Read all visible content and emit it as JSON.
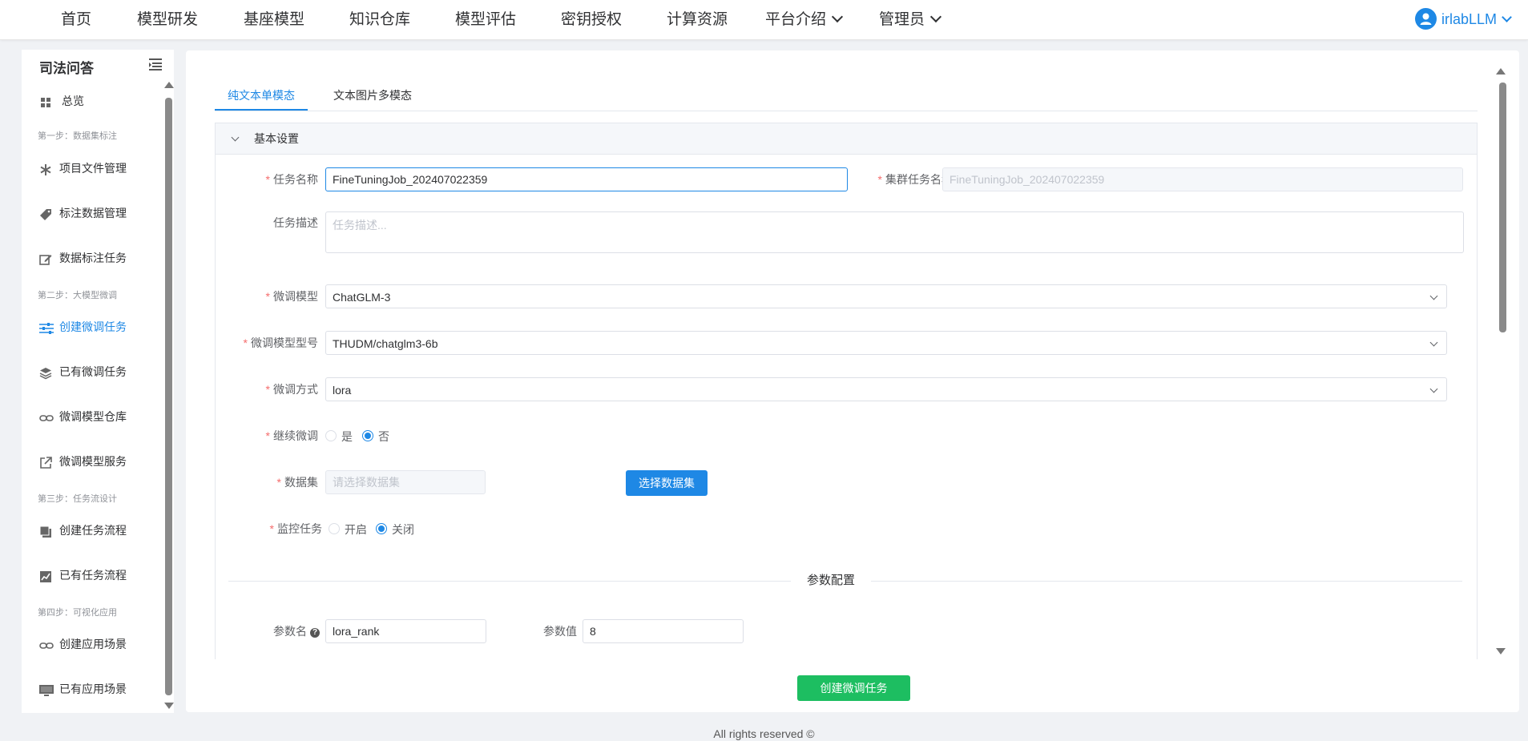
{
  "nav": {
    "items": [
      "首页",
      "模型研发",
      "基座模型",
      "知识仓库",
      "模型评估",
      "密钥授权",
      "计算资源",
      "平台介绍",
      "管理员"
    ],
    "user": "irlabLLM"
  },
  "sidebar": {
    "title": "司法问答",
    "overview": "总览",
    "step1": "第一步：数据集标注",
    "project_files": "项目文件管理",
    "label_data": "标注数据管理",
    "label_tasks": "数据标注任务",
    "step2": "第二步：大模型微调",
    "create_ft": "创建微调任务",
    "existing_ft": "已有微调任务",
    "ft_repo": "微调模型仓库",
    "ft_service": "微调模型服务",
    "step3": "第三步：任务流设计",
    "create_flow": "创建任务流程",
    "existing_flow": "已有任务流程",
    "step4": "第四步：可视化应用",
    "create_app": "创建应用场景",
    "existing_app": "已有应用场景"
  },
  "tabs": [
    "纯文本单模态",
    "文本图片多模态"
  ],
  "form": {
    "section_title": "基本设置",
    "task_name_label": "任务名称",
    "task_name_value": "FineTuningJob_202407022359",
    "cluster_name_label": "集群任务名称",
    "cluster_name_value": "FineTuningJob_202407022359",
    "desc_label": "任务描述",
    "desc_placeholder": "任务描述...",
    "model_label": "微调模型",
    "model_value": "ChatGLM-3",
    "model_type_label": "微调模型型号",
    "model_type_value": "THUDM/chatglm3-6b",
    "method_label": "微调方式",
    "method_value": "lora",
    "continue_label": "继续微调",
    "continue_yes": "是",
    "continue_no": "否",
    "dataset_label": "数据集",
    "dataset_placeholder": "请选择数据集",
    "select_dataset_button": "选择数据集",
    "monitor_label": "监控任务",
    "monitor_on": "开启",
    "monitor_off": "关闭",
    "params_title": "参数配置",
    "param_name_label": "参数名",
    "param_name_value": "lora_rank",
    "param_value_label": "参数值",
    "param_value_value": "8"
  },
  "submit_button": "创建微调任务",
  "footer": "All rights reserved ©",
  "colors": {
    "accent": "#1e88e5",
    "success": "#1dbe61",
    "required": "#f56c6c"
  }
}
